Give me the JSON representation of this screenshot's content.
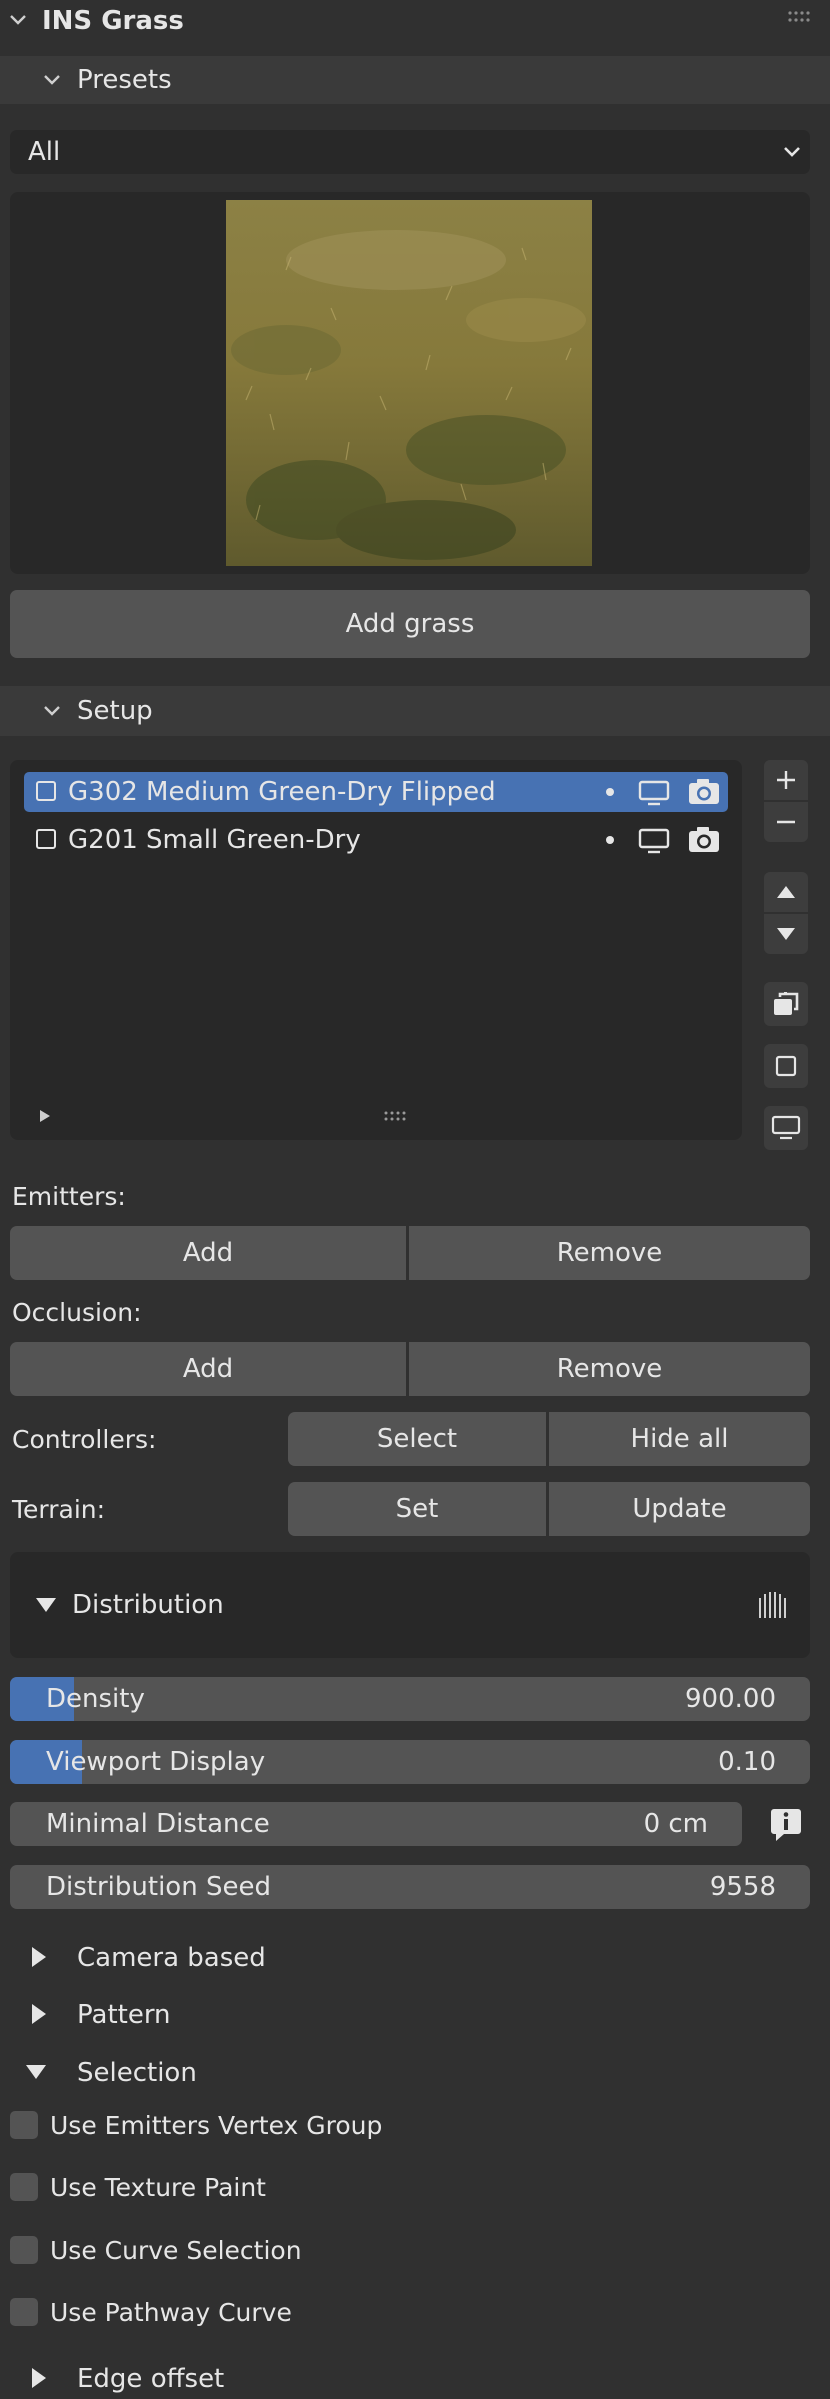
{
  "panel": {
    "title": "INS Grass"
  },
  "presets": {
    "header": "Presets",
    "filter_value": "All",
    "add_button": "Add grass"
  },
  "setup": {
    "header": "Setup",
    "items": [
      {
        "label": "G302 Medium Green-Dry Flipped",
        "selected": true
      },
      {
        "label": "G201 Small Green-Dry",
        "selected": false
      }
    ]
  },
  "emitters": {
    "label": "Emitters:",
    "add": "Add",
    "remove": "Remove"
  },
  "occlusion": {
    "label": "Occlusion:",
    "add": "Add",
    "remove": "Remove"
  },
  "controllers": {
    "label": "Controllers:",
    "select": "Select",
    "hide_all": "Hide all"
  },
  "terrain": {
    "label": "Terrain:",
    "set": "Set",
    "update": "Update"
  },
  "distribution": {
    "header": "Distribution",
    "density": {
      "label": "Density",
      "value": "900.00",
      "fill_fraction": 0.08
    },
    "viewport_display": {
      "label": "Viewport Display",
      "value": "0.10",
      "fill_fraction": 0.1
    },
    "minimal_distance": {
      "label": "Minimal Distance",
      "value": "0 cm"
    },
    "distribution_seed": {
      "label": "Distribution Seed",
      "value": "9558"
    }
  },
  "subpanels": {
    "camera_based": "Camera based",
    "pattern": "Pattern",
    "selection": "Selection",
    "edge_offset": "Edge offset"
  },
  "selection_options": [
    "Use Emitters Vertex Group",
    "Use Texture Paint",
    "Use Curve Selection",
    "Use Pathway Curve"
  ],
  "colors": {
    "background": "#303030",
    "button": "#545454",
    "accent": "#4772b3",
    "list_bg": "#282828"
  }
}
